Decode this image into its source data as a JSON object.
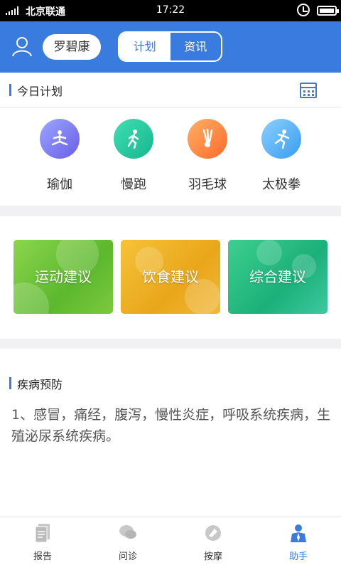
{
  "status_bar": {
    "carrier": "北京联通",
    "time": "17:22"
  },
  "header": {
    "user_name": "罗碧康",
    "tabs": [
      {
        "label": "计划",
        "active": true
      },
      {
        "label": "资讯",
        "active": false
      }
    ]
  },
  "today_plan": {
    "title": "今日计划",
    "activities": [
      {
        "label": "瑜伽",
        "icon": "yoga-icon"
      },
      {
        "label": "慢跑",
        "icon": "jogging-icon"
      },
      {
        "label": "羽毛球",
        "icon": "badminton-icon"
      },
      {
        "label": "太极拳",
        "icon": "taichi-icon"
      }
    ]
  },
  "advice_cards": [
    {
      "label": "运动建议"
    },
    {
      "label": "饮食建议"
    },
    {
      "label": "综合建议"
    }
  ],
  "disease": {
    "title": "疾病预防",
    "content": "1、感冒，痛经，腹泻，慢性炎症，呼吸系统疾病，生殖泌尿系统疾病。"
  },
  "tabbar": [
    {
      "label": "报告",
      "icon": "report-icon",
      "active": false
    },
    {
      "label": "问诊",
      "icon": "consult-icon",
      "active": false
    },
    {
      "label": "按摩",
      "icon": "massage-icon",
      "active": false
    },
    {
      "label": "助手",
      "icon": "assistant-icon",
      "active": true
    }
  ],
  "colors": {
    "primary": "#3a7bdf",
    "section_gap": "#f1f1f4"
  }
}
